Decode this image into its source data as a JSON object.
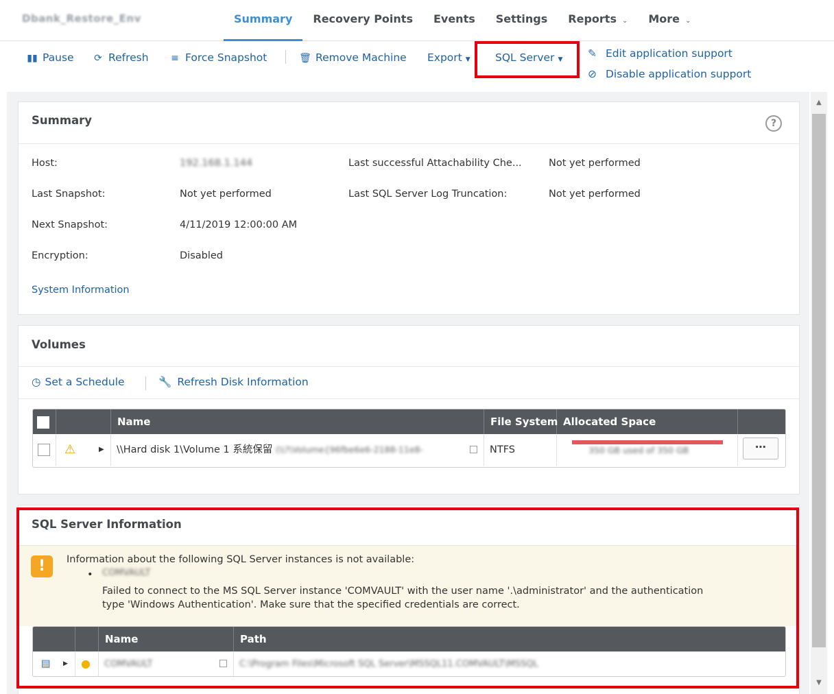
{
  "machine_name": "Dbank_Restore_Env",
  "tabs": [
    {
      "label": "Summary",
      "active": true
    },
    {
      "label": "Recovery Points",
      "active": false
    },
    {
      "label": "Events",
      "active": false
    },
    {
      "label": "Settings",
      "active": false
    },
    {
      "label": "Reports",
      "active": false,
      "dropdown": true
    },
    {
      "label": "More",
      "active": false,
      "dropdown": true
    }
  ],
  "toolbar": {
    "pause": "Pause",
    "refresh": "Refresh",
    "force_snapshot": "Force Snapshot",
    "remove_machine": "Remove Machine",
    "export": "Export",
    "sql_server": "SQL Server",
    "edit_app_support": "Edit application support",
    "disable_app_support": "Disable application support"
  },
  "summary": {
    "title": "Summary",
    "host_label": "Host:",
    "host_value": "192.168.1.144",
    "last_snapshot_label": "Last Snapshot:",
    "last_snapshot_value": "Not yet performed",
    "next_snapshot_label": "Next Snapshot:",
    "next_snapshot_value": "4/11/2019 12:00:00 AM",
    "encryption_label": "Encryption:",
    "encryption_value": "Disabled",
    "attach_check_label": "Last successful Attachability Che...",
    "attach_check_value": "Not yet performed",
    "log_trunc_label": "Last SQL Server Log Truncation:",
    "log_trunc_value": "Not yet performed",
    "system_info_link": "System Information"
  },
  "volumes": {
    "title": "Volumes",
    "set_schedule": "Set a Schedule",
    "refresh_disk": "Refresh Disk Information",
    "columns": [
      "Name",
      "File System",
      "Allocated Space"
    ],
    "rows": [
      {
        "name": "\\\\Hard disk 1\\Volume 1 系統保留",
        "guid": "(\\\\?\\Volume{96fbe6e6-2188-11e8-",
        "file_system": "NTFS",
        "allocated": "350 GB used of 350 GB",
        "used_fraction": 1.0
      }
    ]
  },
  "sql_info": {
    "title": "SQL Server Information",
    "warning_heading": "Information about the following SQL Server instances is not available:",
    "instance": "COMVAULT",
    "error_line1": "Failed to connect to the MS SQL Server instance 'COMVAULT' with the user name '.\\administrator' and the authentication",
    "error_line2": "type 'Windows Authentication'. Make sure that the specified credentials are correct.",
    "columns": [
      "Name",
      "Path"
    ],
    "rows": [
      {
        "name": "COMVAULT",
        "path": "C:\\Program Files\\Microsoft SQL Server\\MSSQL11.COMVAULT\\MSSQL"
      }
    ]
  },
  "colors": {
    "accent": "#3a8fd6",
    "link": "#1e62a8",
    "highlight": "#e3000f",
    "warning": "#f5a623",
    "bar": "#e05a5a"
  }
}
